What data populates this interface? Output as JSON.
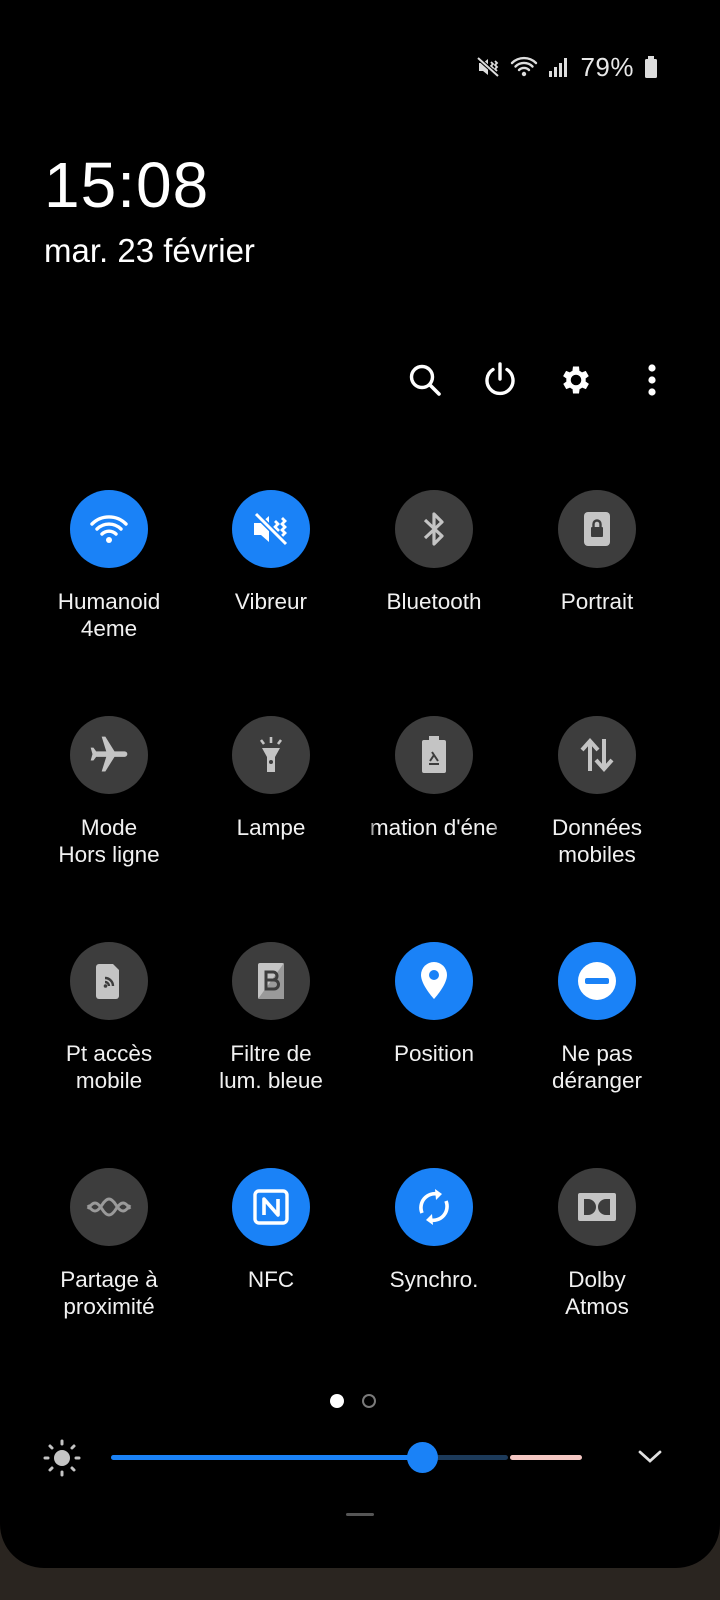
{
  "status_bar": {
    "battery_percent": "79%",
    "icons": [
      "vibrate-mute-icon",
      "wifi-icon",
      "signal-icon",
      "battery-icon"
    ]
  },
  "clock": {
    "time": "15:08",
    "date": "mar. 23 février"
  },
  "actions": [
    "search-icon",
    "power-icon",
    "settings-icon",
    "more-icon"
  ],
  "tiles": [
    {
      "label": "Humanoid\n4eme",
      "icon": "wifi-icon",
      "on": true
    },
    {
      "label": "Vibreur",
      "icon": "vibrate-icon",
      "on": true
    },
    {
      "label": "Bluetooth",
      "icon": "bluetooth-icon",
      "on": false
    },
    {
      "label": "Portrait",
      "icon": "portrait-lock-icon",
      "on": false
    },
    {
      "label": "Mode\nHors ligne",
      "icon": "airplane-icon",
      "on": false
    },
    {
      "label": "Lampe",
      "icon": "flashlight-icon",
      "on": false
    },
    {
      "label": "mation d'éne",
      "icon": "power-saving-icon",
      "on": false
    },
    {
      "label": "Données\nmobiles",
      "icon": "mobile-data-icon",
      "on": false
    },
    {
      "label": "Pt accès\nmobile",
      "icon": "hotspot-icon",
      "on": false
    },
    {
      "label": "Filtre de\nlum. bleue",
      "icon": "blue-light-filter-icon",
      "on": false
    },
    {
      "label": "Position",
      "icon": "location-icon",
      "on": true
    },
    {
      "label": "Ne pas\ndéranger",
      "icon": "do-not-disturb-icon",
      "on": true
    },
    {
      "label": "Partage à\nproximité",
      "icon": "nearby-share-icon",
      "on": false
    },
    {
      "label": "NFC",
      "icon": "nfc-icon",
      "on": true
    },
    {
      "label": "Synchro.",
      "icon": "sync-icon",
      "on": true
    },
    {
      "label": "Dolby\nAtmos",
      "icon": "dolby-icon",
      "on": false
    }
  ],
  "pager": {
    "pages": 2,
    "current": 1
  },
  "brightness": {
    "level": 0.66,
    "colors": {
      "active": "#1a82f7",
      "track": "#1c3a5a",
      "warning": "#f4c7c3"
    }
  },
  "colors": {
    "accent": "#1a82f7",
    "tile_off": "#3d3d3d",
    "background": "#000000"
  }
}
